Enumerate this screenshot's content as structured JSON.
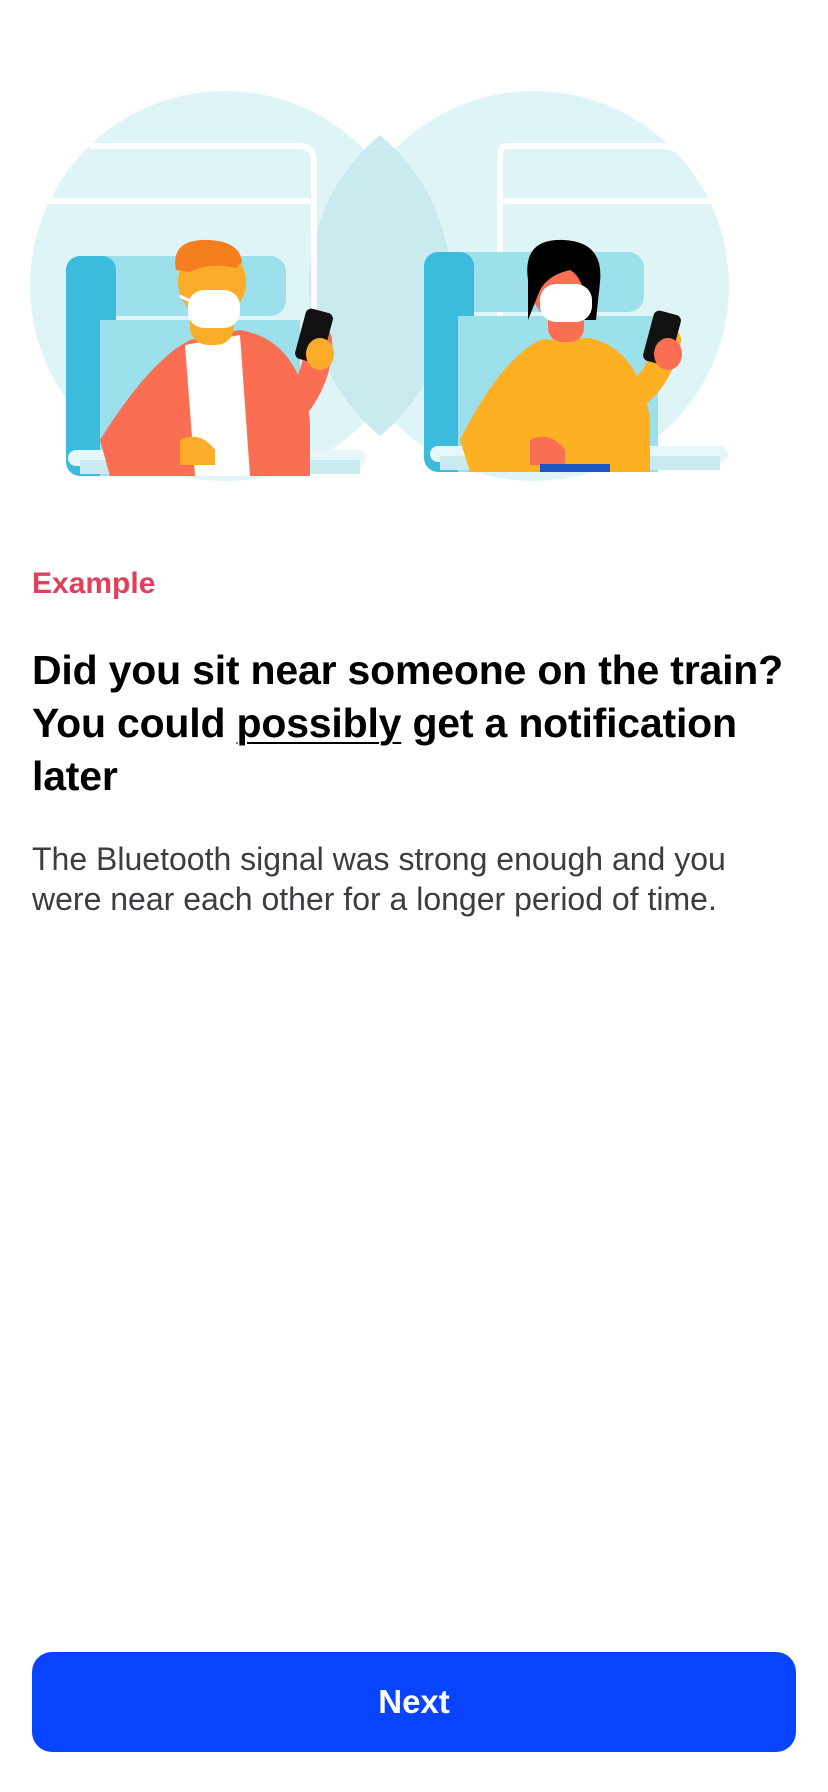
{
  "illustration": {
    "icon": "train-passengers-illustration",
    "colors": {
      "circle": "#dff4f7",
      "seat": "#3bbcdc",
      "seat_light": "#9be0ea",
      "jacket": "#fa6f54",
      "sweater": "#fdb021",
      "skin": "#fbad2a",
      "phone": "#111111",
      "hair_dark": "#000000"
    }
  },
  "eyebrow": "Example",
  "title": {
    "part1": "Did you sit near someone on the train? You could ",
    "emphasis": "possibly",
    "part2": " get a notification later"
  },
  "body": "The Bluetooth signal was strong enough and you were near each other for a longer period of time.",
  "next_button": {
    "label": "Next",
    "color": "#0844ff"
  }
}
